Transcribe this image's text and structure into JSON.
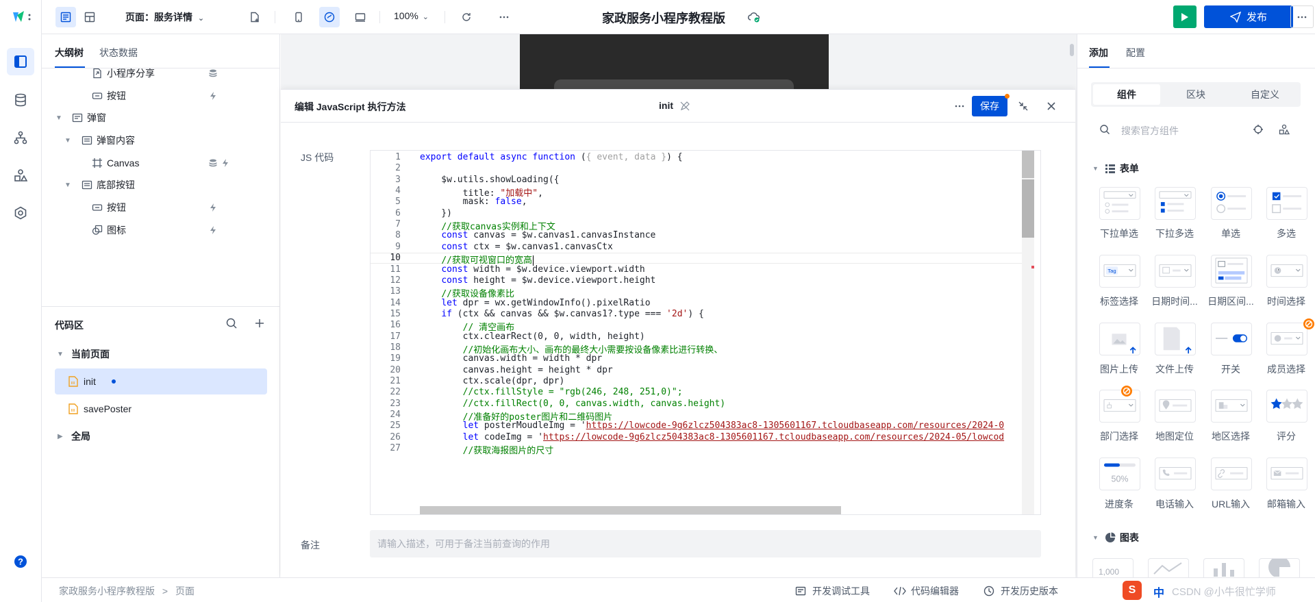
{
  "topbar": {
    "page_label": "页面：服务详情",
    "zoom": "100%",
    "app_title": "家政服务小程序教程版",
    "publish_label": "发布"
  },
  "left_panel": {
    "tabs": [
      "大纲树",
      "状态数据"
    ],
    "tree": [
      {
        "label": "小程序分享",
        "depth": 2,
        "icon": "share-icon"
      },
      {
        "label": "按钮",
        "depth": 2,
        "icon": "button-icon"
      },
      {
        "label": "弹窗",
        "depth": 0,
        "icon": "modal-icon"
      },
      {
        "label": "弹窗内容",
        "depth": 1,
        "icon": "container-icon"
      },
      {
        "label": "Canvas",
        "depth": 2,
        "icon": "canvas-icon"
      },
      {
        "label": "底部按钮",
        "depth": 1,
        "icon": "container-icon"
      },
      {
        "label": "按钮",
        "depth": 2,
        "icon": "button-icon"
      },
      {
        "label": "图标",
        "depth": 2,
        "icon": "image-icon"
      }
    ],
    "code_section_title": "代码区",
    "current_page_label": "当前页面",
    "code_items": [
      "init",
      "savePoster"
    ],
    "global_label": "全局"
  },
  "dialog": {
    "title": "编辑 JavaScript 执行方法",
    "method_name": "init",
    "save_label": "保存",
    "js_label": "JS 代码",
    "remark_label": "备注",
    "remark_placeholder": "请输入描述，可用于备注当前查询的作用",
    "active_line": 10
  },
  "code_lines": [
    "export default async function ({ event, data }) {",
    "",
    "    $w.utils.showLoading({",
    "        title: \"加载中\",",
    "        mask: false,",
    "    })",
    "    //获取canvas实例和上下文",
    "    const canvas = $w.canvas1.canvasInstance",
    "    const ctx = $w.canvas1.canvasCtx",
    "    //获取可视窗口的宽高",
    "    const width = $w.device.viewport.width",
    "    const height = $w.device.viewport.height",
    "    //获取设备像素比",
    "    let dpr = wx.getWindowInfo().pixelRatio",
    "    if (ctx && canvas && $w.canvas1?.type === '2d') {",
    "        // 清空画布",
    "        ctx.clearRect(0, 0, width, height)",
    "        //初始化画布大小、画布的最终大小需要按设备像素比进行转换、",
    "        canvas.width = width * dpr",
    "        canvas.height = height * dpr",
    "        ctx.scale(dpr, dpr)",
    "        //ctx.fillStyle = \"rgb(246, 248, 251,0)\";",
    "        //ctx.fillRect(0, 0, canvas.width, canvas.height)",
    "        //准备好的poster图片和二维码图片",
    "        let posterMoudleImg = 'https://lowcode-9g6zlcz504383ac8-1305601167.tcloudbaseapp.com/resources/2024-0",
    "        let codeImg = 'https://lowcode-9g6zlcz504383ac8-1305601167.tcloudbaseapp.com/resources/2024-05/lowcod",
    "        //获取海报图片的尺寸"
  ],
  "right_panel": {
    "tabs": [
      "添加",
      "配置"
    ],
    "segments": [
      "组件",
      "区块",
      "自定义"
    ],
    "search_placeholder": "搜索官方组件",
    "form_group": "表单",
    "chart_group": "图表",
    "components": [
      "下拉单选",
      "下拉多选",
      "单选",
      "多选",
      "标签选择",
      "日期时间...",
      "日期区间...",
      "时间选择",
      "图片上传",
      "文件上传",
      "开关",
      "成员选择",
      "部门选择",
      "地图定位",
      "地区选择",
      "评分",
      "进度条",
      "电话输入",
      "URL输入",
      "邮箱输入"
    ],
    "progress_text": "50%",
    "tag_text": "Tag",
    "chart_thumb_text": "1,000"
  },
  "statusbar": {
    "breadcrumb": [
      "家政服务小程序教程版",
      "页面"
    ],
    "actions": [
      "开发调试工具",
      "代码编辑器",
      "开发历史版本"
    ],
    "ime_label": "中",
    "watermark": "CSDN @小牛很忙学师"
  },
  "colors": {
    "primary": "#0052d9",
    "success": "#00a870",
    "selected_bg": "#dbe7ff"
  }
}
